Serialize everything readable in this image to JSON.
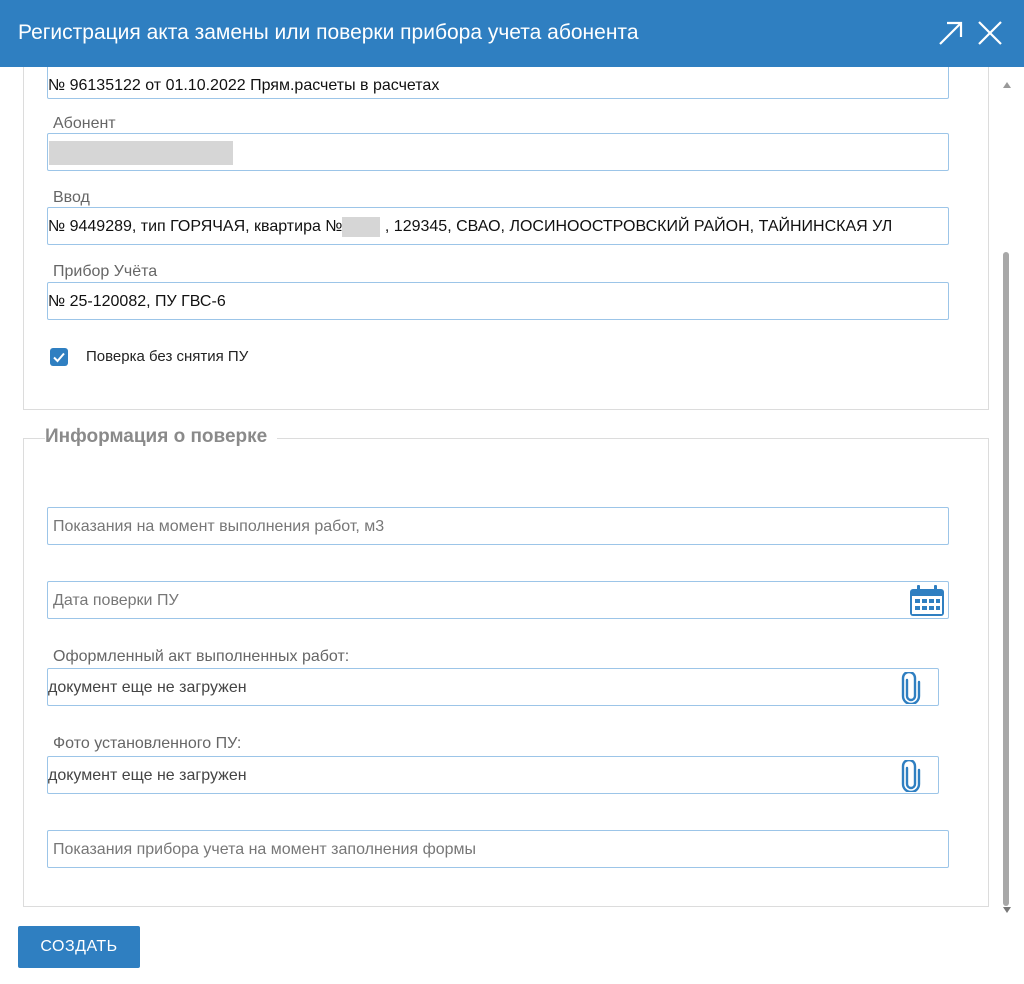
{
  "window": {
    "title": "Регистрация акта замены или поверки прибора учета абонента"
  },
  "top_section": {
    "prev_field_value": "№ 96135122 от 01.10.2022 Прям.расчеты в расчетах",
    "subscriber_label": "Абонент",
    "input_label": "Ввод",
    "input_value_prefix": "№ 9449289, тип ГОРЯЧАЯ, квартира №",
    "input_value_suffix": " , 129345, СВАО, ЛОСИНООСТРОВСКИЙ РАЙОН, ТАЙНИНСКАЯ УЛ",
    "meter_label": "Прибор Учёта",
    "meter_value": "№ 25-120082, ПУ ГВС-6",
    "checkbox_label": "Поверка без снятия ПУ",
    "checkbox_checked": true
  },
  "verification_section": {
    "legend": "Информация о поверке",
    "readings_placeholder": "Показания на момент выполнения работ, м3",
    "date_placeholder": "Дата поверки ПУ",
    "act_label": "Оформленный акт выполненных работ:",
    "act_value": "документ еще не загружен",
    "photo_label": "Фото установленного ПУ:",
    "photo_value": "документ еще не загружен",
    "form_readings_placeholder": "Показания прибора учета на момент заполнения формы"
  },
  "actions": {
    "create_label": "СОЗДАТЬ"
  },
  "colors": {
    "accent": "#2f7fc1",
    "input_border": "#9cc5e8"
  }
}
